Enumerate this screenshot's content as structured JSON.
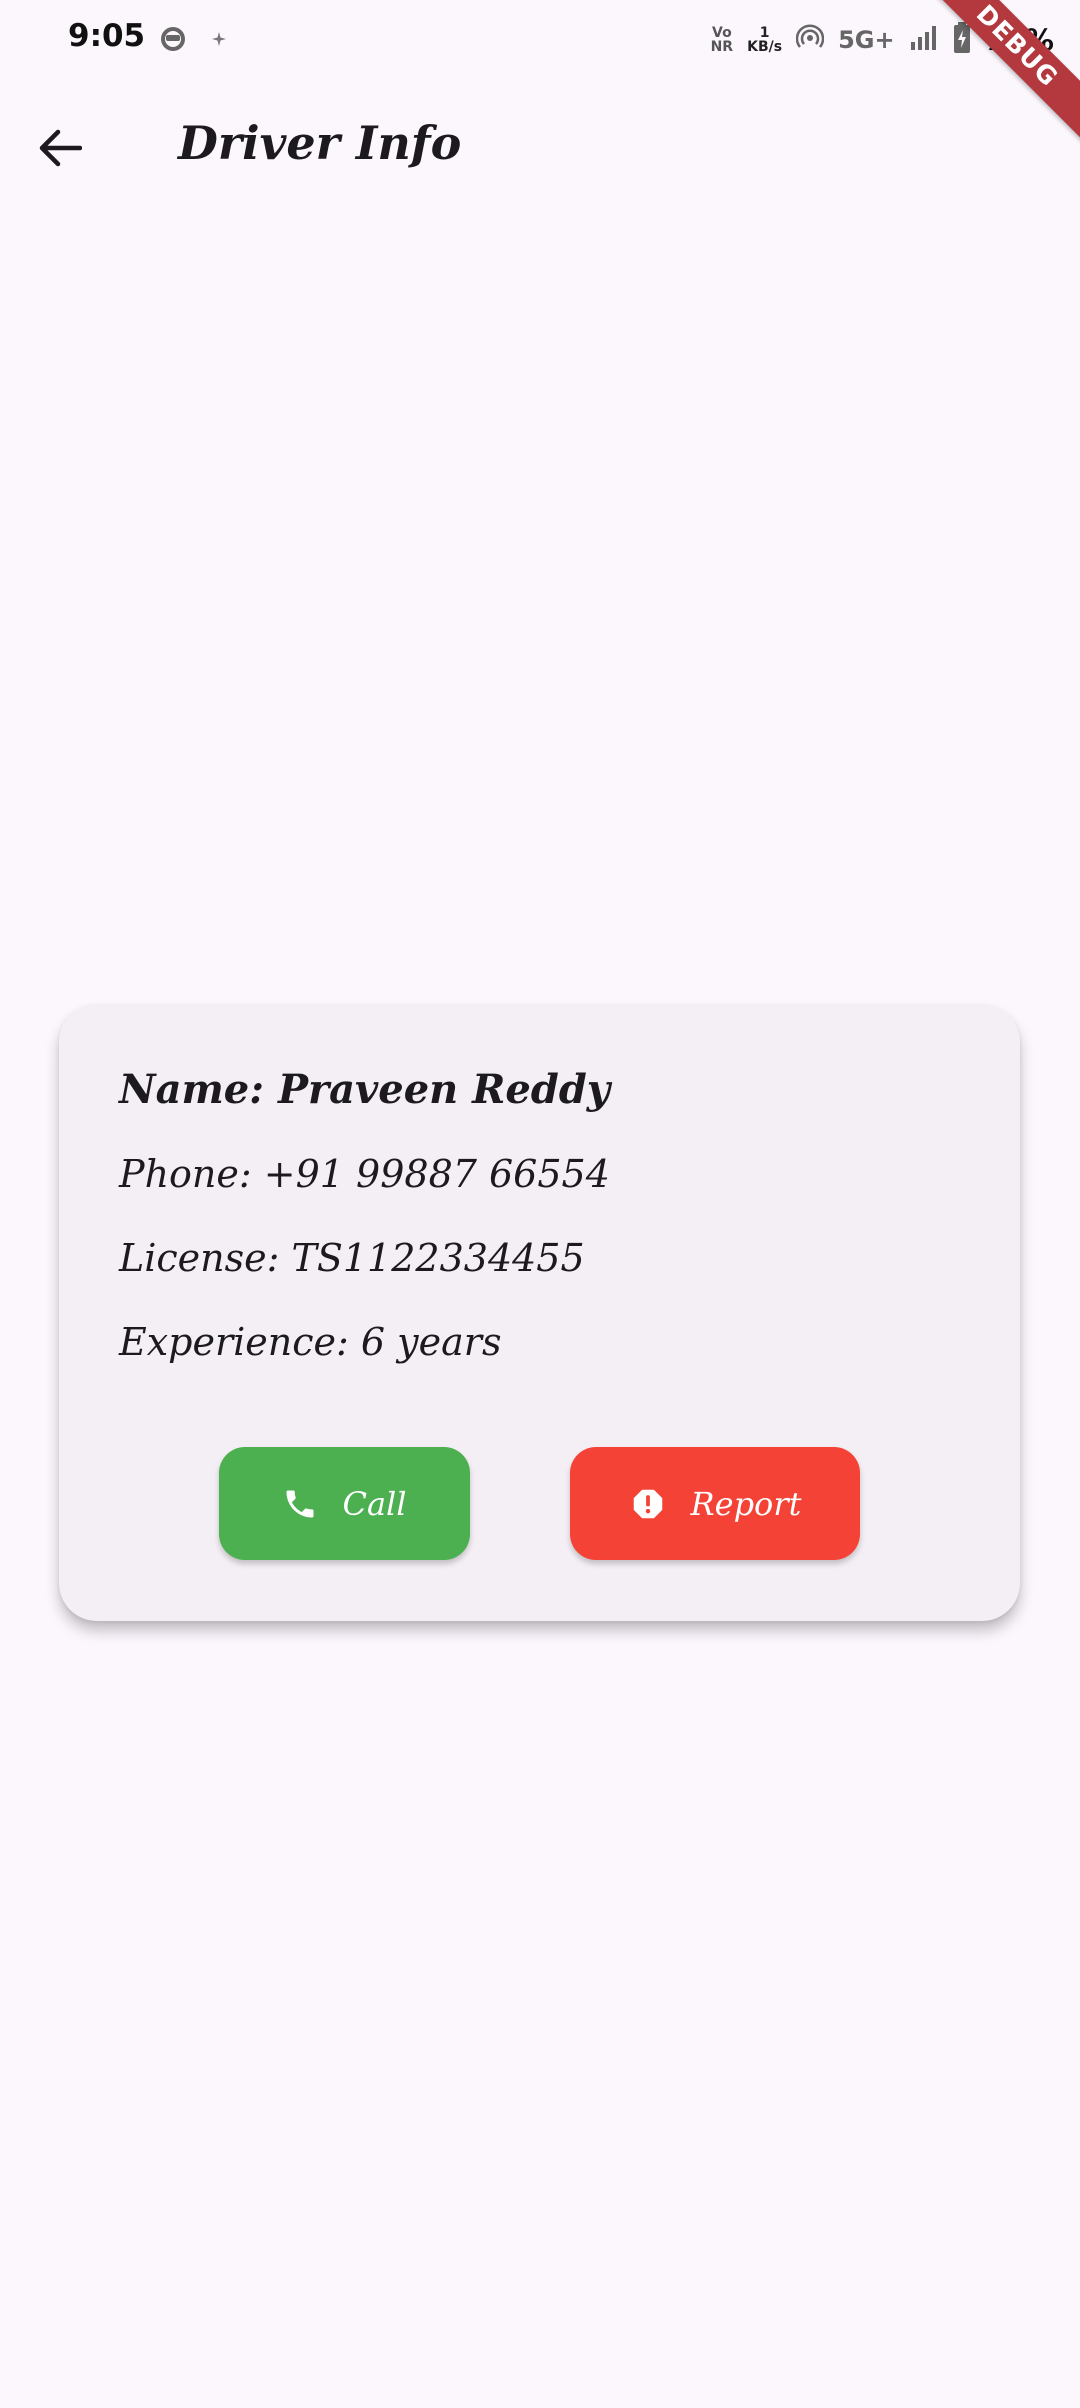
{
  "status_bar": {
    "time": "9:05",
    "volte_top": "Vo",
    "volte_bottom": "NR",
    "speed_value": "1",
    "speed_unit": "KB/s",
    "network": "5G+",
    "battery": "78%"
  },
  "debug_banner": "DEBUG",
  "app_bar": {
    "title": "Driver Info"
  },
  "driver": {
    "name": "Name: Praveen Reddy",
    "phone": "Phone: +91 99887 66554",
    "license": "License: TS1122334455",
    "experience": "Experience: 6 years"
  },
  "actions": {
    "call_label": "Call",
    "report_label": "Report"
  },
  "colors": {
    "background": "#fcf6fd",
    "card": "#f4eff5",
    "call": "#4caf50",
    "report": "#f44336",
    "debug_banner": "#b3393f"
  }
}
